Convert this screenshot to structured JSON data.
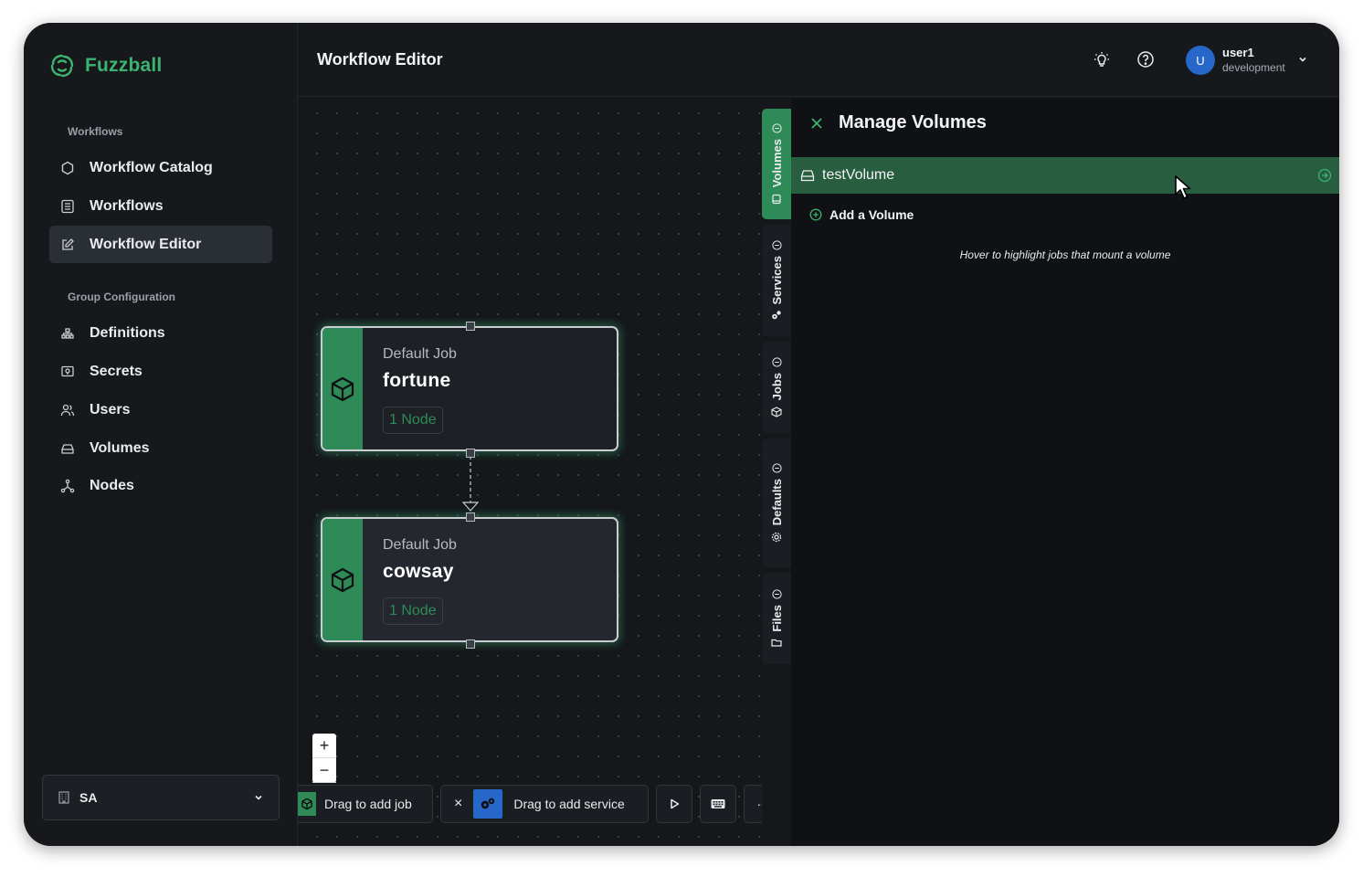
{
  "app": {
    "name": "Fuzzball"
  },
  "sidebar": {
    "sections": [
      {
        "title": "Workflows",
        "items": [
          {
            "label": "Workflow Catalog",
            "icon": "hexagon-icon"
          },
          {
            "label": "Workflows",
            "icon": "list-icon"
          },
          {
            "label": "Workflow Editor",
            "icon": "edit-icon",
            "active": true
          }
        ]
      },
      {
        "title": "Group Configuration",
        "items": [
          {
            "label": "Definitions",
            "icon": "hierarchy-icon"
          },
          {
            "label": "Secrets",
            "icon": "secret-icon"
          },
          {
            "label": "Users",
            "icon": "users-icon"
          },
          {
            "label": "Volumes",
            "icon": "drive-icon"
          },
          {
            "label": "Nodes",
            "icon": "nodes-icon"
          }
        ]
      }
    ],
    "org": {
      "label": "SA"
    }
  },
  "header": {
    "title": "Workflow Editor",
    "user": {
      "initial": "U",
      "name": "user1",
      "env": "development"
    }
  },
  "canvas": {
    "jobs": [
      {
        "type": "Default Job",
        "name": "fortune",
        "badge": "1 Node"
      },
      {
        "type": "Default Job",
        "name": "cowsay",
        "badge": "1 Node"
      }
    ],
    "zoom": {
      "in": "+",
      "out": "−"
    },
    "toolbar": {
      "add_job": "Drag to add job",
      "close": "×",
      "add_service": "Drag to add service",
      "more": "···"
    }
  },
  "rail": {
    "tabs": [
      "Volumes",
      "Services",
      "Jobs",
      "Defaults",
      "Files"
    ],
    "active": "Volumes"
  },
  "panel": {
    "title": "Manage Volumes",
    "volumes": [
      "testVolume"
    ],
    "add_label": "Add a Volume",
    "hint": "Hover to highlight jobs that mount a volume"
  },
  "colors": {
    "accent": "#2e8b57",
    "brand": "#3cb371",
    "background": "#16181c",
    "avatar": "#2767c9"
  }
}
